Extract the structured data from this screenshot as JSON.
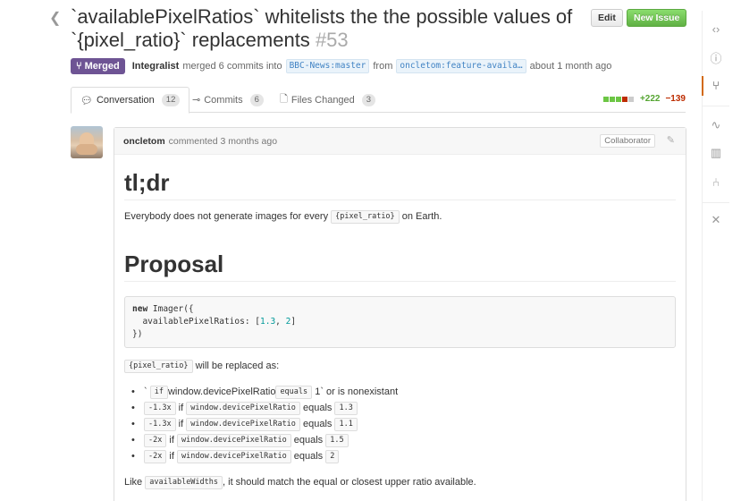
{
  "header": {
    "title": "`availablePixelRatios` whitelists the the possible values of `{pixel_ratio}` replacements",
    "number": "#53",
    "edit_label": "Edit",
    "new_issue_label": "New Issue"
  },
  "meta": {
    "state": "Merged",
    "author": "Integralist",
    "merged_text": "merged 6 commits into",
    "base_branch": "BBC-News:master",
    "from_text": "from",
    "head_branch": "oncletom:feature-availa…",
    "time": "about 1 month ago"
  },
  "tabs": [
    {
      "label": "Conversation",
      "count": "12"
    },
    {
      "label": "Commits",
      "count": "6"
    },
    {
      "label": "Files Changed",
      "count": "3"
    }
  ],
  "diffstat": {
    "additions": "+222",
    "deletions": "−139"
  },
  "comment": {
    "author": "oncletom",
    "action": "commented 3 months ago",
    "role": "Collaborator",
    "h1": "tl;dr",
    "tldr_before": "Everybody does not generate images for every",
    "tldr_code": "{pixel_ratio}",
    "tldr_after": "on Earth.",
    "h2": "Proposal",
    "code_kw": "new",
    "code_line1": " Imager({",
    "code_line2_a": "  availablePixelRatios: [",
    "code_num1": "1.3",
    "code_sep": ", ",
    "code_num2": "2",
    "code_line2_b": "]",
    "code_line3": "})",
    "replaced_code": "{pixel_ratio}",
    "replaced_text": "will be replaced as:",
    "list": [
      {
        "pre": "`",
        "code1": "if",
        "mid": "window.devicePixelRatio",
        "code2": "equals",
        "post": "1` or is nonexistant"
      },
      {
        "code1": "-1.3x",
        "if": "if",
        "code2": "window.devicePixelRatio",
        "eq": "equals",
        "code3": "1.3"
      },
      {
        "code1": "-1.3x",
        "if": "if",
        "code2": "window.devicePixelRatio",
        "eq": "equals",
        "code3": "1.1"
      },
      {
        "code1": "-2x",
        "if": "if",
        "code2": "window.devicePixelRatio",
        "eq": "equals",
        "code3": "1.5"
      },
      {
        "code1": "-2x",
        "if": "if",
        "code2": "window.devicePixelRatio",
        "eq": "equals",
        "code3": "2"
      }
    ],
    "like_text": "Like",
    "like_code": "availableWidths",
    "like_after": ", it should match the equal or closest upper ratio available."
  },
  "rail": [
    "code-icon",
    "issue-icon",
    "pull-request-icon",
    "pulse-icon",
    "graph-icon",
    "network-icon",
    "settings-icon"
  ],
  "colors": {
    "merged": "#6e5494",
    "new_issue": "#60b044",
    "add": "#55a532",
    "del": "#bd2c00"
  }
}
